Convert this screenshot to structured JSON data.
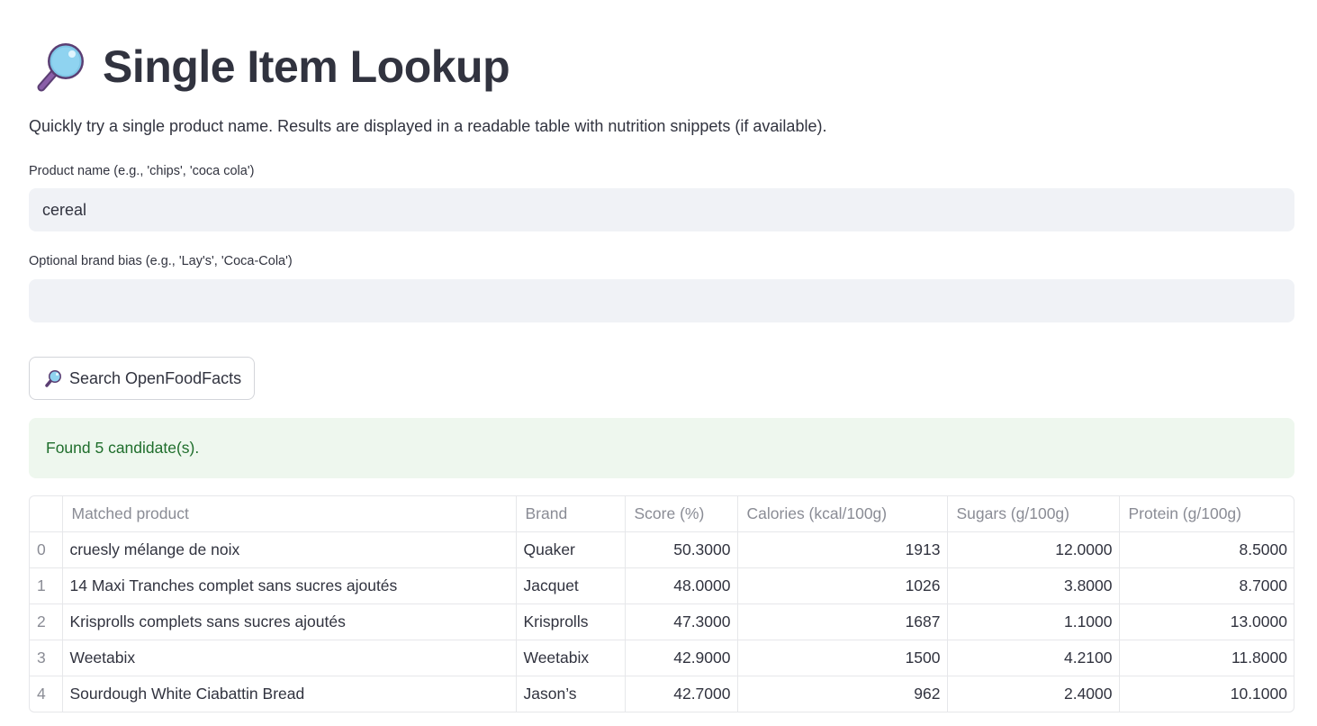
{
  "page": {
    "title": "Single Item Lookup",
    "subtitle": "Quickly try a single product name. Results are displayed in a readable table with nutrition snippets (if available).",
    "title_icon": "magnifying-glass-icon"
  },
  "form": {
    "product_label": "Product name (e.g., 'chips', 'coca cola')",
    "product_value": "cereal",
    "brand_label": "Optional brand bias (e.g., 'Lay's', 'Coca-Cola')",
    "brand_value": "",
    "search_button_label": "Search OpenFoodFacts",
    "search_button_icon": "magnifying-glass-icon"
  },
  "alert": {
    "message": "Found 5 candidate(s).",
    "color": "#1f6e2c",
    "background": "#eef7ee"
  },
  "table": {
    "columns": [
      "",
      "Matched product",
      "Brand",
      "Score (%)",
      "Calories (kcal/100g)",
      "Sugars (g/100g)",
      "Protein (g/100g)"
    ],
    "rows": [
      {
        "index": "0",
        "product": "cruesly mélange de noix",
        "brand": "Quaker",
        "score": "50.3000",
        "calories": "1913",
        "sugars": "12.0000",
        "protein": "8.5000"
      },
      {
        "index": "1",
        "product": "14 Maxi Tranches complet sans sucres ajoutés",
        "brand": "Jacquet",
        "score": "48.0000",
        "calories": "1026",
        "sugars": "3.8000",
        "protein": "8.7000"
      },
      {
        "index": "2",
        "product": "Krisprolls complets sans sucres ajoutés",
        "brand": "Krisprolls",
        "score": "47.3000",
        "calories": "1687",
        "sugars": "1.1000",
        "protein": "13.0000"
      },
      {
        "index": "3",
        "product": "Weetabix",
        "brand": "Weetabix",
        "score": "42.9000",
        "calories": "1500",
        "sugars": "4.2100",
        "protein": "11.8000"
      },
      {
        "index": "4",
        "product": "Sourdough White Ciabattin Bread",
        "brand": "Jason’s",
        "score": "42.7000",
        "calories": "962",
        "sugars": "2.4000",
        "protein": "10.1000"
      }
    ]
  }
}
